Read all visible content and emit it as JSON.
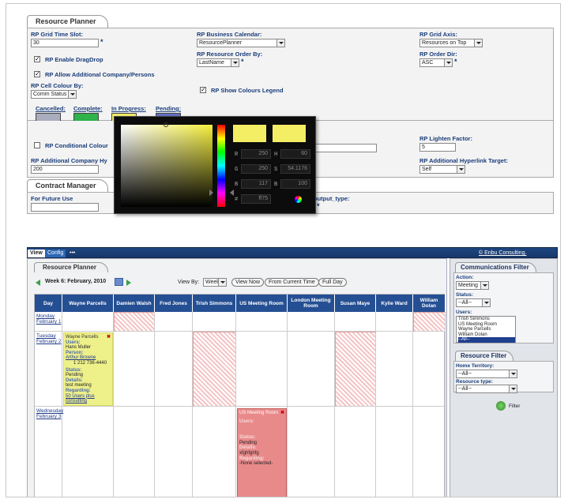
{
  "upper": {
    "rp_tab": "Resource Planner",
    "grid_time_slot_label": "RP Grid Time Slot:",
    "grid_time_slot_value": "30",
    "business_calendar_label": "RP Business Calendar:",
    "business_calendar_value": "ResourcePlanner",
    "grid_axis_label": "RP Grid Axis:",
    "grid_axis_value": "Resources on Top",
    "enable_dragdrop_label": "RP Enable DragDrop",
    "resource_order_label": "RP Resource Order By:",
    "resource_order_value": "LastName",
    "order_dir_label": "RP Order Dir:",
    "order_dir_value": "ASC",
    "allow_additional_label": "RP Allow Additional Company/Persons",
    "cell_colour_label": "RP Cell Colour By:",
    "cell_colour_value": "Comm Status",
    "show_colours_legend_label": "RP Show Colours Legend",
    "legend": [
      {
        "label": "Cancelled:",
        "color": "#a9adbd"
      },
      {
        "label": "Complete:",
        "color": "#2fb34a"
      },
      {
        "label": "In Progress:",
        "color": "#f2ee6a"
      },
      {
        "label": "Pending:",
        "color": "#6470c4"
      }
    ],
    "conditional_colour_label": "RP Conditional Colour",
    "additional_company_label": "RP Additional Company Hy",
    "additional_company_value": "200",
    "lighten_factor_label": "RP Lighten Factor:",
    "lighten_factor_value": "5",
    "hidden_label_fragment": "):",
    "hyperlink_target_label": "RP Additional Hyperlink Target:",
    "hyperlink_target_value": "Self",
    "cm_tab": "Contract Manager",
    "future_use_label": "For Future Use",
    "output_type_label": "output_type:",
    "picker": {
      "r_label": "R",
      "r_value": "250",
      "g_label": "G",
      "g_value": "250",
      "b_label": "B",
      "b_value": "117",
      "h_label": "H",
      "h_value": "60",
      "s_label": "S",
      "s_value": "54.1176",
      "bv_label": "B",
      "bv_value": "100",
      "hex_label": "#",
      "hex_value": "ff75",
      "current_color": "#f4ee64"
    }
  },
  "lower": {
    "tabs": {
      "view": "View",
      "config": "Config",
      "more": "•••"
    },
    "brand_link": "© Enbu Consulting.",
    "rp_tab": "Resource Planner",
    "week_label": "Week 6: February, 2010",
    "view_by_label": "View By:",
    "view_by_value": "Week",
    "view_now": "View Now",
    "from_current_time": "From Current Time",
    "full_day": "Full Day",
    "columns": [
      "Day",
      "Wayne Parcells",
      "Damien Walsh",
      "Fred Jones",
      "Trish Simmons",
      "US Meeting Room",
      "London Meeting Room",
      "Susan Maye",
      "Kylie Ward",
      "William Dolan"
    ],
    "days": [
      {
        "name": "Monday",
        "date": "February 1"
      },
      {
        "name": "Tuesday",
        "date": "February 2"
      },
      {
        "name": "Wednesday",
        "date": "February 3"
      }
    ],
    "event1": {
      "owner": "Wayne Parcells",
      "users_label": "Users:",
      "users_value": "Hans Muller",
      "person_label": "Person:",
      "person_value": "Arthur Browne",
      "phone": "1 212 736-4440",
      "status_label": "Status:",
      "status_value": "Pending",
      "details_label": "Details:",
      "details_value": "test meeting",
      "regarding_label": "Regarding:",
      "regarding_value": "50 Users plus consulting"
    },
    "event2": {
      "owner": "US Meeting Room",
      "users_label": "Users:",
      "status_label": "Status:",
      "status_value": "Pending",
      "details_label": "Details:",
      "details_value": "xfghfghfg",
      "regarding_label": "Regarding:",
      "regarding_value": "-None selected-"
    },
    "comm_filter": {
      "title": "Communications Filter",
      "action_label": "Action:",
      "action_value": "Meeting",
      "status_label": "Status:",
      "status_value": "--All--",
      "users_label": "Users:",
      "users": [
        "Trish Simmons",
        "US Meeting Room",
        "Wayne Parcells",
        "William Dolan",
        "--All--"
      ]
    },
    "res_filter": {
      "title": "Resource Filter",
      "territory_label": "Home Territory:",
      "territory_value": "--All--",
      "type_label": "Resource type:",
      "type_value": "--All--",
      "filter_label": "Filter"
    }
  }
}
